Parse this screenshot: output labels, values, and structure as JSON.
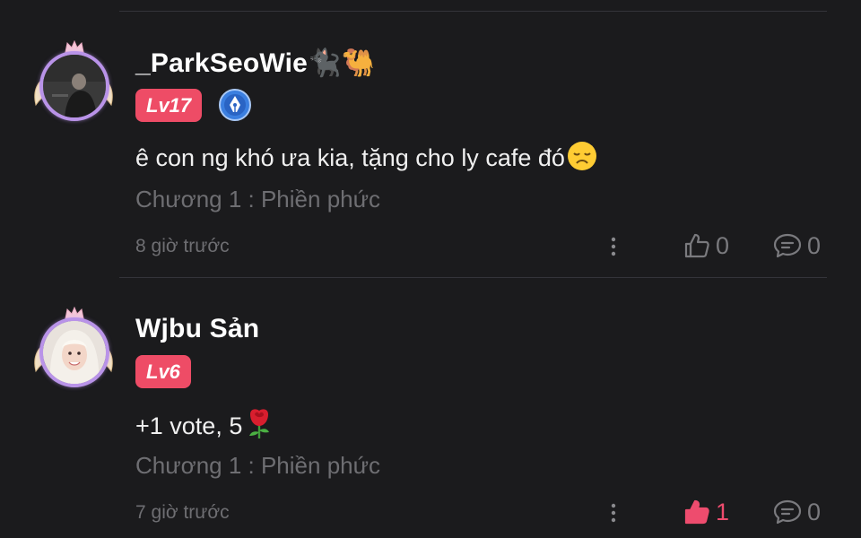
{
  "comments": [
    {
      "username": "_ParkSeoWie🐈‍⬛🐫",
      "level": "Lv17",
      "has_author_badge": true,
      "text": "ê con ng khó ưa kia, tặng cho ly cafe đó",
      "emoji": "disappointed-face",
      "chapter": "Chương 1 : Phiền phức",
      "time": "8 giờ trước",
      "likes": "0",
      "liked": false,
      "replies": "0"
    },
    {
      "username": "Wjbu Sản",
      "level": "Lv6",
      "has_author_badge": false,
      "text": "+1 vote, 5",
      "emoji": "rose",
      "chapter": "Chương 1 : Phiền phức",
      "time": "7 giờ trước",
      "likes": "1",
      "liked": true,
      "replies": "0"
    }
  ],
  "colors": {
    "background": "#1b1b1d",
    "level_badge": "#ee4c66",
    "liked": "#ee4c6e",
    "muted": "#6e6e72",
    "avatar_ring": "#b993e8"
  },
  "icons": {
    "more": "more-vertical-icon",
    "like": "thumbs-up-icon",
    "reply": "comment-bubble-icon",
    "author_badge": "pen-nib-badge-icon"
  }
}
